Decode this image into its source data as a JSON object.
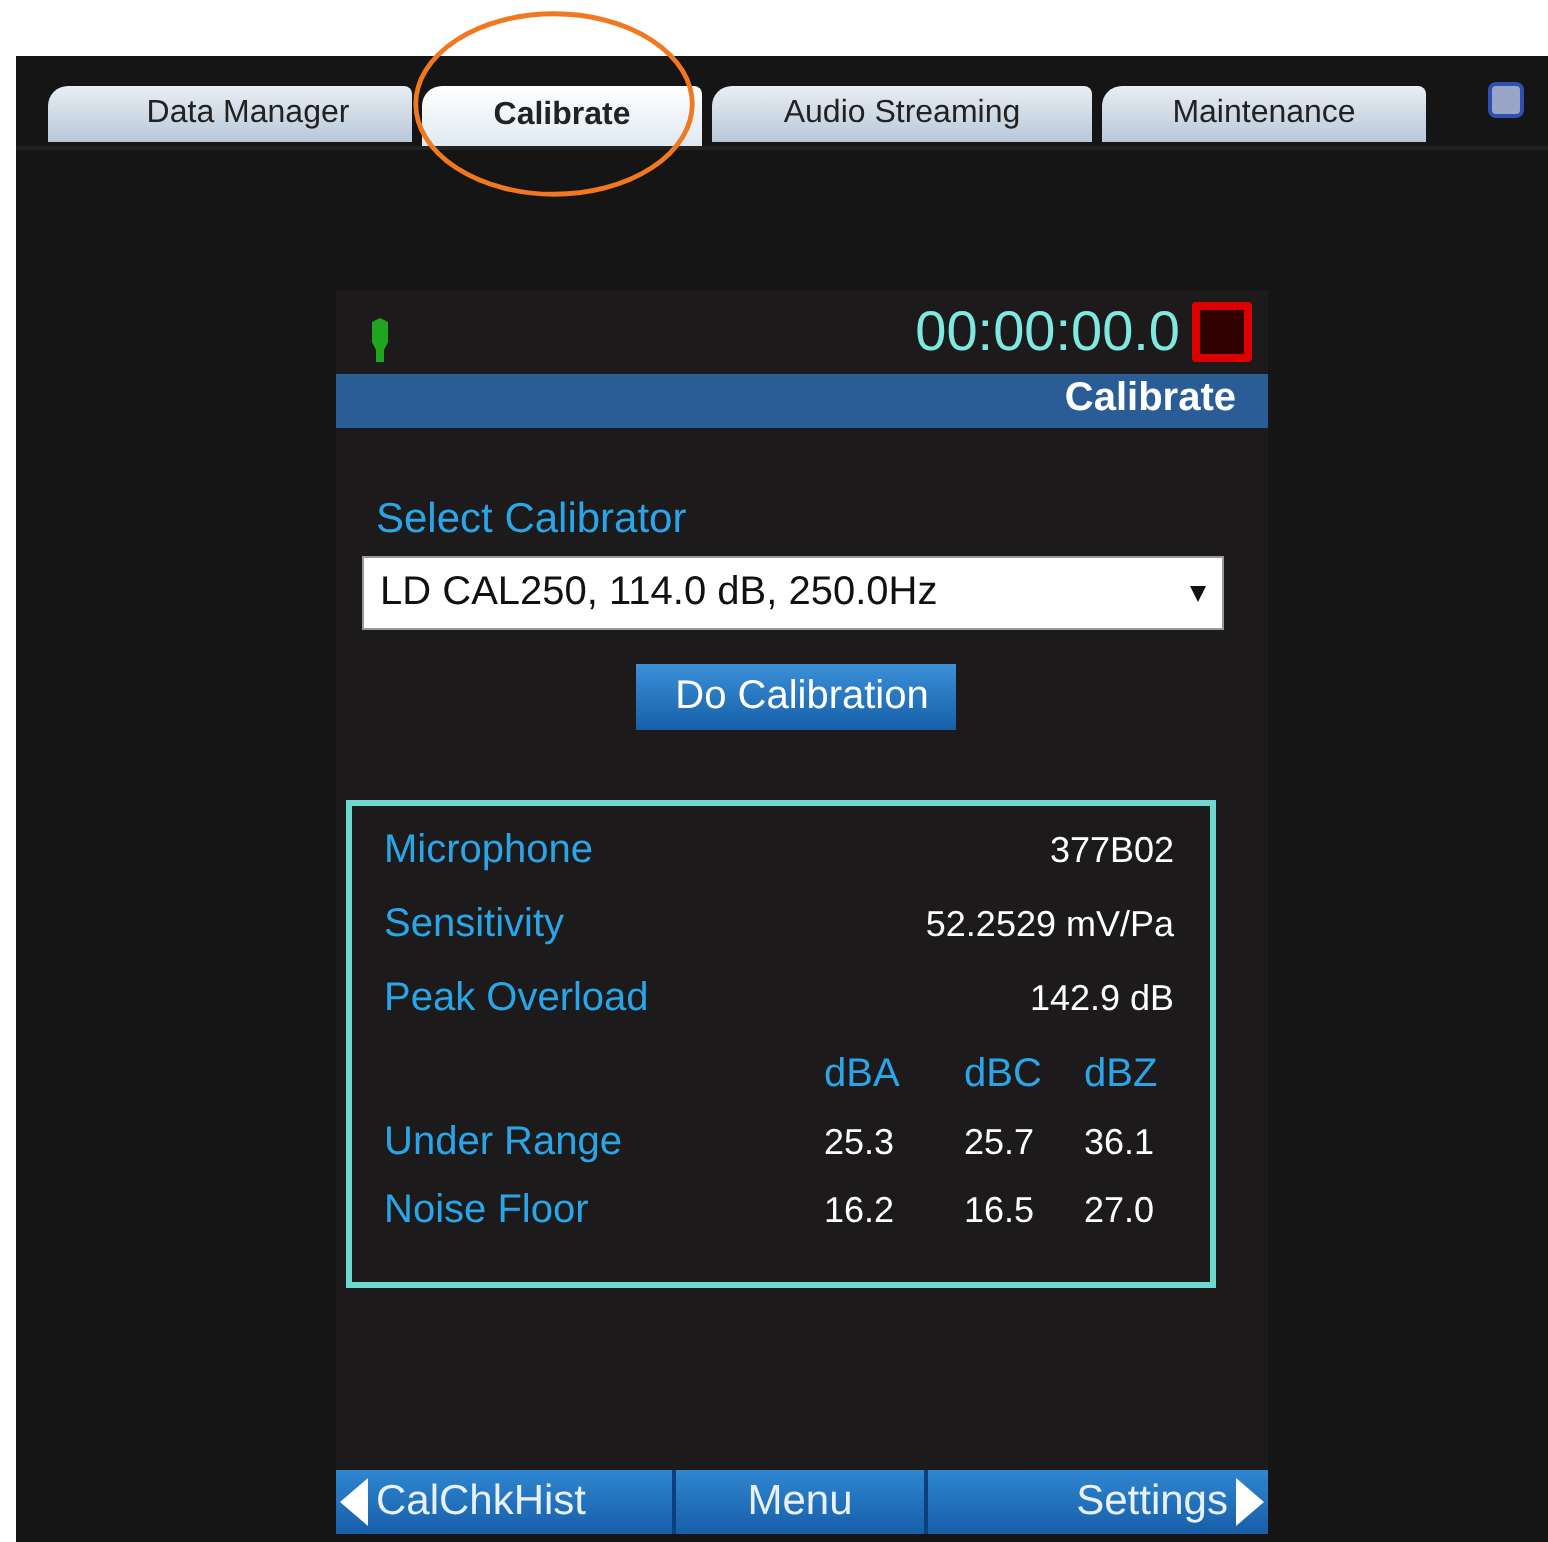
{
  "tabs": [
    {
      "label": "Data Manager",
      "selected": false
    },
    {
      "label": "Calibrate",
      "selected": true
    },
    {
      "label": "Audio Streaming",
      "selected": false
    },
    {
      "label": "Maintenance",
      "selected": false
    }
  ],
  "status": {
    "time": "00:00:00.0"
  },
  "title_bar": "Calibrate",
  "calibrator": {
    "label": "Select Calibrator",
    "value": "LD CAL250, 114.0 dB, 250.0Hz"
  },
  "action_button": "Do Calibration",
  "info": {
    "rows": [
      {
        "label": "Microphone",
        "value": "377B02"
      },
      {
        "label": "Sensitivity",
        "value": "52.2529 mV/Pa"
      },
      {
        "label": "Peak Overload",
        "value": "142.9 dB"
      }
    ],
    "columns": [
      "dBA",
      "dBC",
      "dBZ"
    ],
    "levels": [
      {
        "label": "Under Range",
        "values": [
          "25.3",
          "25.7",
          "36.1"
        ]
      },
      {
        "label": "Noise Floor",
        "values": [
          "16.2",
          "16.5",
          "27.0"
        ]
      }
    ]
  },
  "nav": [
    {
      "label": "CalChkHist",
      "kind": "prev"
    },
    {
      "label": "Menu",
      "kind": "center"
    },
    {
      "label": "Settings",
      "kind": "next"
    }
  ]
}
